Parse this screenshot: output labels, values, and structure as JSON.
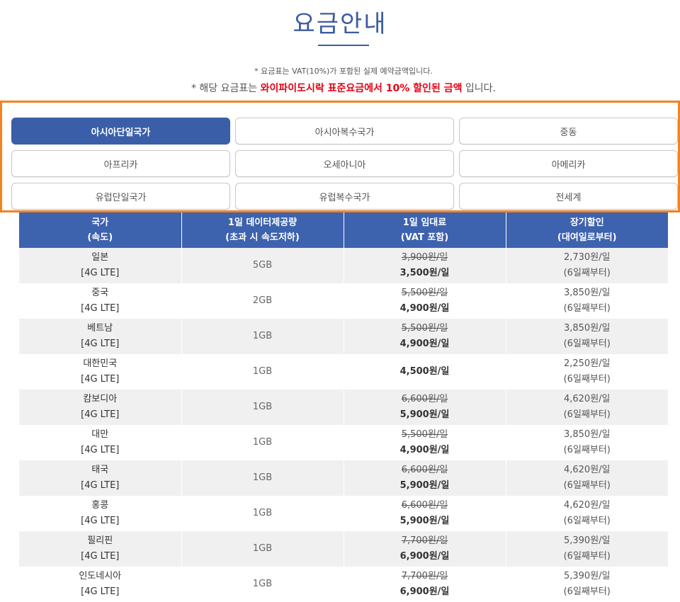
{
  "header": {
    "title": "요금안내",
    "note_vat": "* 요금표는 VAT(10%)가 포함된 실제 예약금액입니다.",
    "note_discount_prefix": "* 해당 요금표는 ",
    "note_discount_highlight": "와이파이도시락 표준요금에서 10% 할인된 금액",
    "note_discount_suffix": " 입니다."
  },
  "tabs": [
    {
      "label": "아시아단일국가",
      "active": true
    },
    {
      "label": "아시아복수국가",
      "active": false
    },
    {
      "label": "중동",
      "active": false
    },
    {
      "label": "아프리카",
      "active": false
    },
    {
      "label": "오세아니아",
      "active": false
    },
    {
      "label": "아메리카",
      "active": false
    },
    {
      "label": "유럽단일국가",
      "active": false
    },
    {
      "label": "유럽복수국가",
      "active": false
    },
    {
      "label": "전세계",
      "active": false
    }
  ],
  "table": {
    "headers": [
      {
        "line1": "국가",
        "line2": "(속도)"
      },
      {
        "line1": "1일 데이터제공량",
        "line2": "(초과 시 속도저하)"
      },
      {
        "line1": "1일 임대료",
        "line2": "(VAT 포함)"
      },
      {
        "line1": "장기할인",
        "line2": "(대여일로부터)"
      }
    ],
    "rows": [
      {
        "country": "일본",
        "speed": "[4G LTE]",
        "data": "5GB",
        "orig_price": "3,900원/일",
        "price": "3,500원/일",
        "long_price": "2,730원/일",
        "long_cond": "(6일째부터)"
      },
      {
        "country": "중국",
        "speed": "[4G LTE]",
        "data": "2GB",
        "orig_price": "5,500원/일",
        "price": "4,900원/일",
        "long_price": "3,850원/일",
        "long_cond": "(6일째부터)"
      },
      {
        "country": "베트남",
        "speed": "[4G LTE]",
        "data": "1GB",
        "orig_price": "5,500원/일",
        "price": "4,900원/일",
        "long_price": "3,850원/일",
        "long_cond": "(6일째부터)"
      },
      {
        "country": "대한민국",
        "speed": "[4G LTE]",
        "data": "1GB",
        "orig_price": "",
        "price": "4,500원/일",
        "long_price": "2,250원/일",
        "long_cond": "(6일째부터)"
      },
      {
        "country": "캄보디아",
        "speed": "[4G LTE]",
        "data": "1GB",
        "orig_price": "6,600원/일",
        "price": "5,900원/일",
        "long_price": "4,620원/일",
        "long_cond": "(6일째부터)"
      },
      {
        "country": "대만",
        "speed": "[4G LTE]",
        "data": "1GB",
        "orig_price": "5,500원/일",
        "price": "4,900원/일",
        "long_price": "3,850원/일",
        "long_cond": "(6일째부터)"
      },
      {
        "country": "태국",
        "speed": "[4G LTE]",
        "data": "1GB",
        "orig_price": "6,600원/일",
        "price": "5,900원/일",
        "long_price": "4,620원/일",
        "long_cond": "(6일째부터)"
      },
      {
        "country": "홍콩",
        "speed": "[4G LTE]",
        "data": "1GB",
        "orig_price": "6,600원/일",
        "price": "5,900원/일",
        "long_price": "4,620원/일",
        "long_cond": "(6일째부터)"
      },
      {
        "country": "필리핀",
        "speed": "[4G LTE]",
        "data": "1GB",
        "orig_price": "7,700원/일",
        "price": "6,900원/일",
        "long_price": "5,390원/일",
        "long_cond": "(6일째부터)"
      },
      {
        "country": "인도네시아",
        "speed": "[4G LTE]",
        "data": "1GB",
        "orig_price": "7,700원/일",
        "price": "6,900원/일",
        "long_price": "5,390원/일",
        "long_cond": "(6일째부터)"
      }
    ]
  },
  "colors": {
    "title_blue": "#3d5c9e",
    "header_blue": "#3d62ae",
    "active_tab": "#3a5fa8",
    "highlight_red": "#e60012",
    "frame_orange": "#f58220"
  }
}
